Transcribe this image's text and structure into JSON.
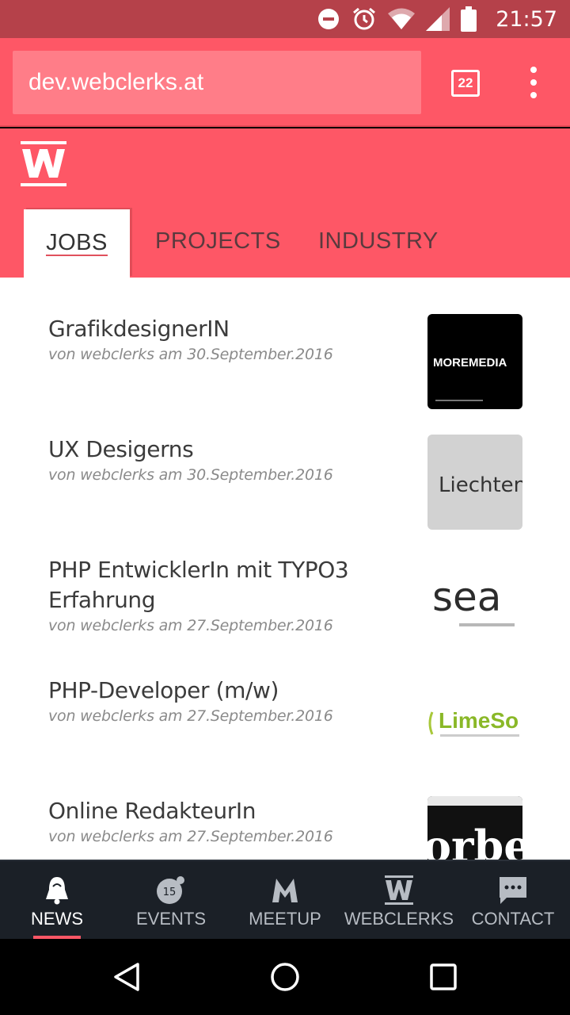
{
  "status_bar": {
    "time": "21:57",
    "icons": [
      "do-not-disturb-icon",
      "alarm-icon",
      "wifi-icon",
      "signal-icon",
      "battery-icon"
    ]
  },
  "browser": {
    "url": "dev.webclerks.at",
    "tab_count": "22"
  },
  "site": {
    "tabs": [
      {
        "label": "JOBS",
        "active": true
      },
      {
        "label": "PROJECTS",
        "active": false
      },
      {
        "label": "INDUSTRY",
        "active": false
      }
    ]
  },
  "jobs": [
    {
      "title": "GrafikdesignerIN",
      "meta": "von webclerks am 30.September.2016",
      "thumb_text": "MOREMEDIA"
    },
    {
      "title": "UX Desigerns",
      "meta": "von webclerks am 30.September.2016",
      "thumb_text": "Liechten"
    },
    {
      "title": "PHP EntwicklerIn mit TYPO3 Erfahrung",
      "meta": "von webclerks am 27.September.2016",
      "thumb_text": "sea"
    },
    {
      "title": "PHP-Developer (m/w)",
      "meta": "von webclerks am 27.September.2016",
      "thumb_text": "LimeSo"
    },
    {
      "title": "Online RedakteurIn",
      "meta": "von webclerks am 27.September.2016",
      "thumb_text": "orbe"
    }
  ],
  "bottom_nav": [
    {
      "label": "NEWS",
      "icon": "bell-icon",
      "active": true
    },
    {
      "label": "EVENTS",
      "icon": "calendar-badge-icon",
      "badge": "15",
      "active": false
    },
    {
      "label": "MEETUP",
      "icon": "meetup-icon",
      "active": false
    },
    {
      "label": "WEBCLERKS",
      "icon": "webclerks-icon",
      "active": false
    },
    {
      "label": "CONTACT",
      "icon": "chat-icon",
      "active": false
    }
  ],
  "colors": {
    "accent": "#fe5766",
    "status_bar": "#b5414a",
    "nav_bg": "#1b2027"
  }
}
